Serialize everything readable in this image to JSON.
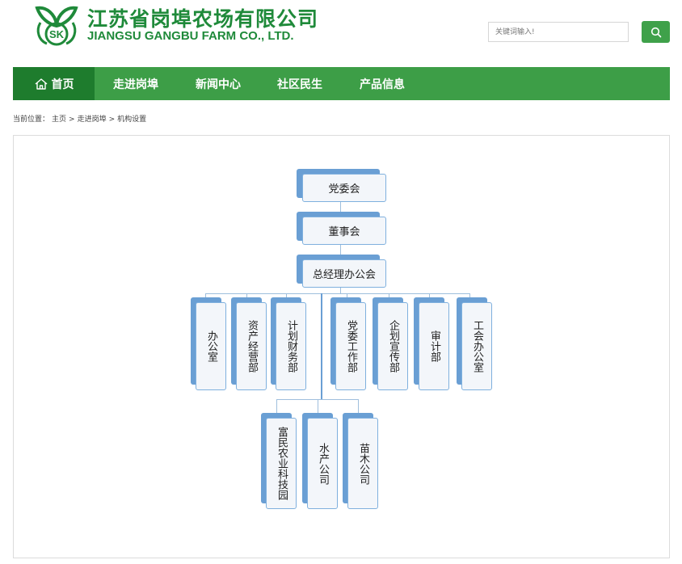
{
  "brand": {
    "name_cn": "江苏省岗埠农场有限公司",
    "name_en": "JIANGSU GANGBU FARM CO., LTD.",
    "logo_text": "SK"
  },
  "search": {
    "placeholder": "关键词输入!",
    "button_icon": "search-icon"
  },
  "nav": {
    "items": [
      {
        "label": "首页",
        "icon": "home-icon",
        "active": true
      },
      {
        "label": "走进岗埠"
      },
      {
        "label": "新闻中心"
      },
      {
        "label": "社区民生"
      },
      {
        "label": "产品信息"
      }
    ]
  },
  "breadcrumb": {
    "prefix": "当前位置：",
    "items": [
      "主页",
      "走进岗埠",
      "机构设置"
    ],
    "separator": ">"
  },
  "org": {
    "top": [
      "党委会",
      "董事会",
      "总经理办公会"
    ],
    "departments": [
      "办公室",
      "资产经营部",
      "计划财务部",
      "党委工作部",
      "企划宣传部",
      "审计部",
      "工会办公室"
    ],
    "subsidiaries": [
      "富民农业科技园",
      "水产公司",
      "苗木公司"
    ]
  },
  "colors": {
    "brand_green": "#1f8a3a",
    "nav_green": "#3d9e47",
    "nav_active": "#1e7c2d",
    "node_blue": "#6a9fd4"
  }
}
